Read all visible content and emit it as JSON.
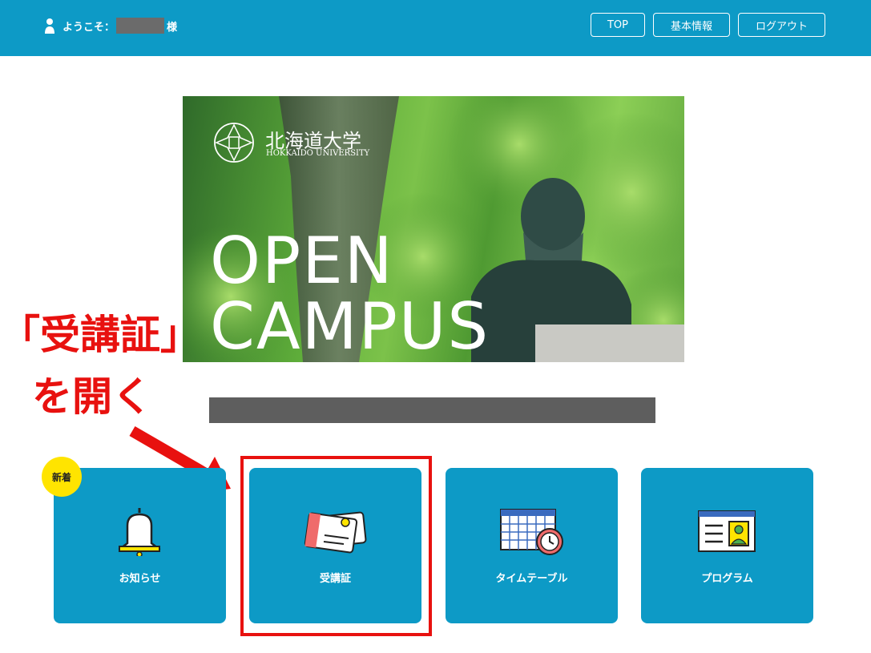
{
  "header": {
    "welcome_prefix": "ようこそ：",
    "welcome_suffix": "様",
    "nav": [
      "TOP",
      "基本情報",
      "ログアウト"
    ]
  },
  "hero": {
    "university_jp": "北海道大学",
    "university_en": "HOKKAIDO UNIVERSITY",
    "title_line1": "OPEN",
    "title_line2": "CAMPUS"
  },
  "annotation": {
    "line1": "「受講証」",
    "line2": "を開く"
  },
  "badge": "新着",
  "tiles": [
    {
      "label": "お知らせ",
      "icon": "bell-icon"
    },
    {
      "label": "受講証",
      "icon": "ticket-icon"
    },
    {
      "label": "タイムテーブル",
      "icon": "timetable-icon"
    },
    {
      "label": "プログラム",
      "icon": "program-icon"
    }
  ],
  "colors": {
    "header": "#0d9ac6",
    "tile": "#0d9ac6",
    "annotation": "#e8110f",
    "badge": "#ffe400"
  }
}
